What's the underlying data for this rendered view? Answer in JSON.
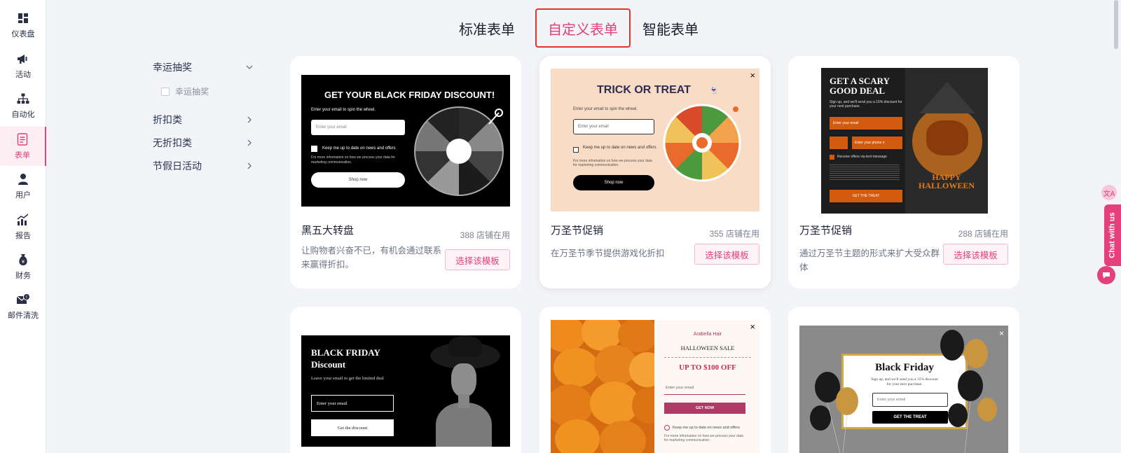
{
  "nav": {
    "items": [
      {
        "label": "仪表盘",
        "icon": "dashboard-icon"
      },
      {
        "label": "活动",
        "icon": "megaphone-icon"
      },
      {
        "label": "自动化",
        "icon": "flow-icon"
      },
      {
        "label": "表单",
        "icon": "form-icon"
      },
      {
        "label": "用户",
        "icon": "user-icon"
      },
      {
        "label": "报告",
        "icon": "report-icon"
      },
      {
        "label": "财务",
        "icon": "finance-icon"
      },
      {
        "label": "邮件清洗",
        "icon": "mail-clean-icon"
      }
    ],
    "active": "表单"
  },
  "tabs": [
    {
      "label": "标准表单"
    },
    {
      "label": "自定义表单"
    },
    {
      "label": "智能表单"
    }
  ],
  "categories": {
    "groups": [
      {
        "label": "幸运抽奖",
        "expanded": true,
        "sub": "幸运抽奖"
      },
      {
        "label": "折扣类"
      },
      {
        "label": "无折扣类"
      },
      {
        "label": "节假日活动"
      }
    ]
  },
  "cards": [
    {
      "title": "黑五大转盘",
      "usage": "388 店铺在用",
      "desc": "让购物者兴奋不已，有机会通过联系来赢得折扣。",
      "button": "选择该模板",
      "preview": {
        "heading": "GET YOUR BLACK FRIDAY DISCOUNT!",
        "sub": "Enter your email to spin the wheel.",
        "email_placeholder": "Enter your email",
        "consent": "Keep me up to date on news and offers",
        "info": "For more information on how we process your data for marketing communication.",
        "cta": "Shop now"
      }
    },
    {
      "title": "万圣节促销",
      "usage": "355 店铺在用",
      "desc": "在万圣节季节提供游戏化折扣",
      "button": "选择该模板",
      "preview": {
        "heading": "TRICK OR TREAT",
        "sub": "Enter your email to spin the wheel.",
        "email_placeholder": "Enter your email",
        "consent": "Keep me up to date on news and offers",
        "info": "For more information on how we process your data for marketing communication.",
        "cta": "Shop now"
      }
    },
    {
      "title": "万圣节促销",
      "usage": "288 店铺在用",
      "desc": "通过万圣节主题的形式来扩大受众群体",
      "button": "选择该模板",
      "preview": {
        "heading": "GET A SCARY GOOD DEAL",
        "sub": "Sign up, and we'll send you a 15% discount for your next purchase.",
        "email_placeholder": "Enter your email",
        "phone_placeholder": "Enter your phone n",
        "consent": "Receive offers via text message",
        "cta": "GET THE TREAT",
        "badge": "HAPPY HALLOWEEN"
      }
    },
    {
      "preview": {
        "heading": "BLACK FRIDAY Discount",
        "sub": "Leave your email to get the limited deal",
        "email_placeholder": "Enter your email",
        "cta": "Get the discount"
      }
    },
    {
      "preview": {
        "brand": "Arabella Hair",
        "heading": "HALLOWEEN SALE",
        "offer": "UP TO $100 OFF",
        "email_placeholder": "Enter your email",
        "cta": "GET NOW",
        "consent": "Keep me up to date on news and offers",
        "info": "For more information on how we process your data for marketing communication."
      }
    },
    {
      "preview": {
        "heading": "Black Friday",
        "sub": "Sign up, and we'll send you a 15% discount for your next purchase.",
        "email_placeholder": "Enter your email",
        "cta": "GET THE TREAT"
      }
    }
  ],
  "floating": {
    "chat_label": "Chat with us"
  },
  "colors": {
    "accent": "#e4407b",
    "tab_border": "#e0322e",
    "nav_text": "#2b2f45"
  }
}
